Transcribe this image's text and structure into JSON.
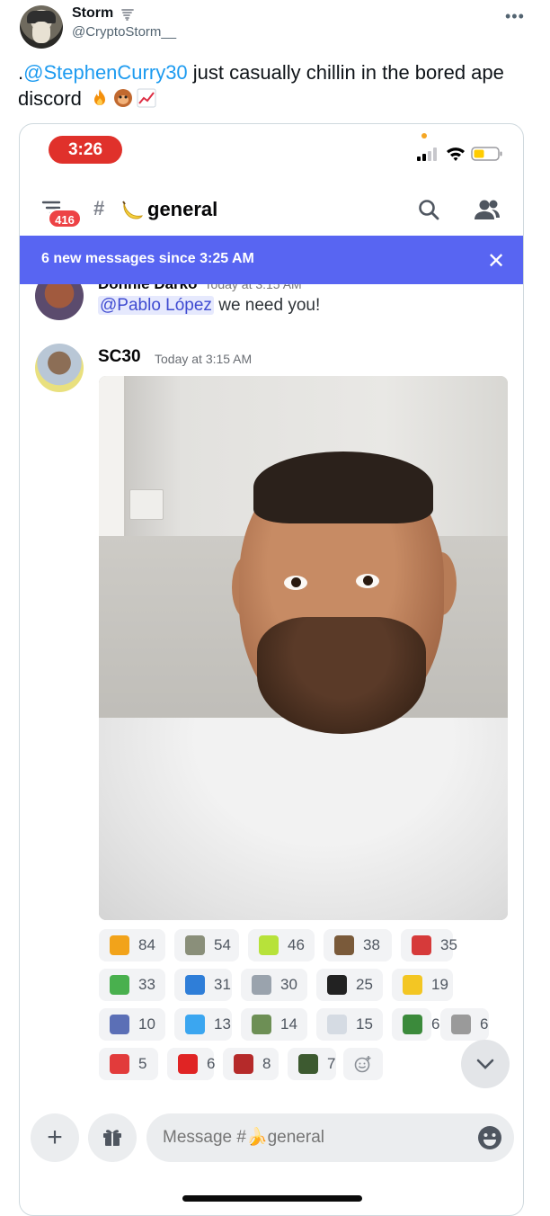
{
  "tweet": {
    "display_name": "Storm",
    "handle": "@CryptoStorm__",
    "more_label": "•••",
    "text_prefix": ".",
    "mention": "@StephenCurry30",
    "text_body": " just casually chillin in the bored ape discord"
  },
  "phone": {
    "time": "3:26",
    "unread_badge": "416",
    "channel_hash": "#",
    "channel_name": "general",
    "new_messages_text": "6 new messages since 3:25 AM",
    "close_label": "✕"
  },
  "previous_message": {
    "author": "Donnie Darko",
    "timestamp": "Today at 3:15 AM",
    "mention": "@Pablo López",
    "text": " we need you!"
  },
  "message": {
    "author": "SC30",
    "timestamp": "Today at 3:15 AM"
  },
  "reactions": [
    {
      "icon": "fire-emoji",
      "count": "84",
      "color": "#f2a31a"
    },
    {
      "icon": "ape-yes-emoji",
      "count": "54",
      "color": "#8a8f7a"
    },
    {
      "icon": "lfg-emoji",
      "count": "46",
      "color": "#b7e23a"
    },
    {
      "icon": "ape-emoji",
      "count": "38",
      "color": "#7a5a3a"
    },
    {
      "icon": "joeg-emoji",
      "count": "35",
      "color": "#d63a3a"
    },
    {
      "icon": "brem-emoji",
      "count": "33",
      "color": "#49b04e"
    },
    {
      "icon": "nice-emoji",
      "count": "31",
      "color": "#2f7ed8"
    },
    {
      "icon": "eyes-sideways-emoji",
      "count": "30",
      "color": "#9aa3ad"
    },
    {
      "icon": "eyes-emoji",
      "count": "25",
      "color": "#222222"
    },
    {
      "icon": "banana-emoji",
      "count": "19",
      "color": "#f3c623"
    },
    {
      "icon": "ape-portrait-emoji",
      "count": "10",
      "color": "#5b6fb6"
    },
    {
      "icon": "splash-emoji",
      "count": "13",
      "color": "#3ba6f0"
    },
    {
      "icon": "ape-drink-emoji",
      "count": "14",
      "color": "#6d8f55"
    },
    {
      "icon": "cloud-emoji",
      "count": "15",
      "color": "#d5dbe3"
    },
    {
      "icon": "pepe-emoji",
      "count": "6",
      "color": "#3b8a3b"
    },
    {
      "icon": "cat-emoji",
      "count": "6",
      "color": "#9a9a9a"
    },
    {
      "icon": "hundred-emoji",
      "count": "5",
      "color": "#e23b3b"
    },
    {
      "icon": "he-emoji",
      "count": "6",
      "color": "#e02424"
    },
    {
      "icon": "daddy-emoji",
      "count": "8",
      "color": "#b52a2a"
    },
    {
      "icon": "ape-sign-emoji",
      "count": "7",
      "color": "#3d5a30"
    }
  ],
  "composer": {
    "plus_label": "+",
    "placeholder": "Message #🍌general"
  }
}
